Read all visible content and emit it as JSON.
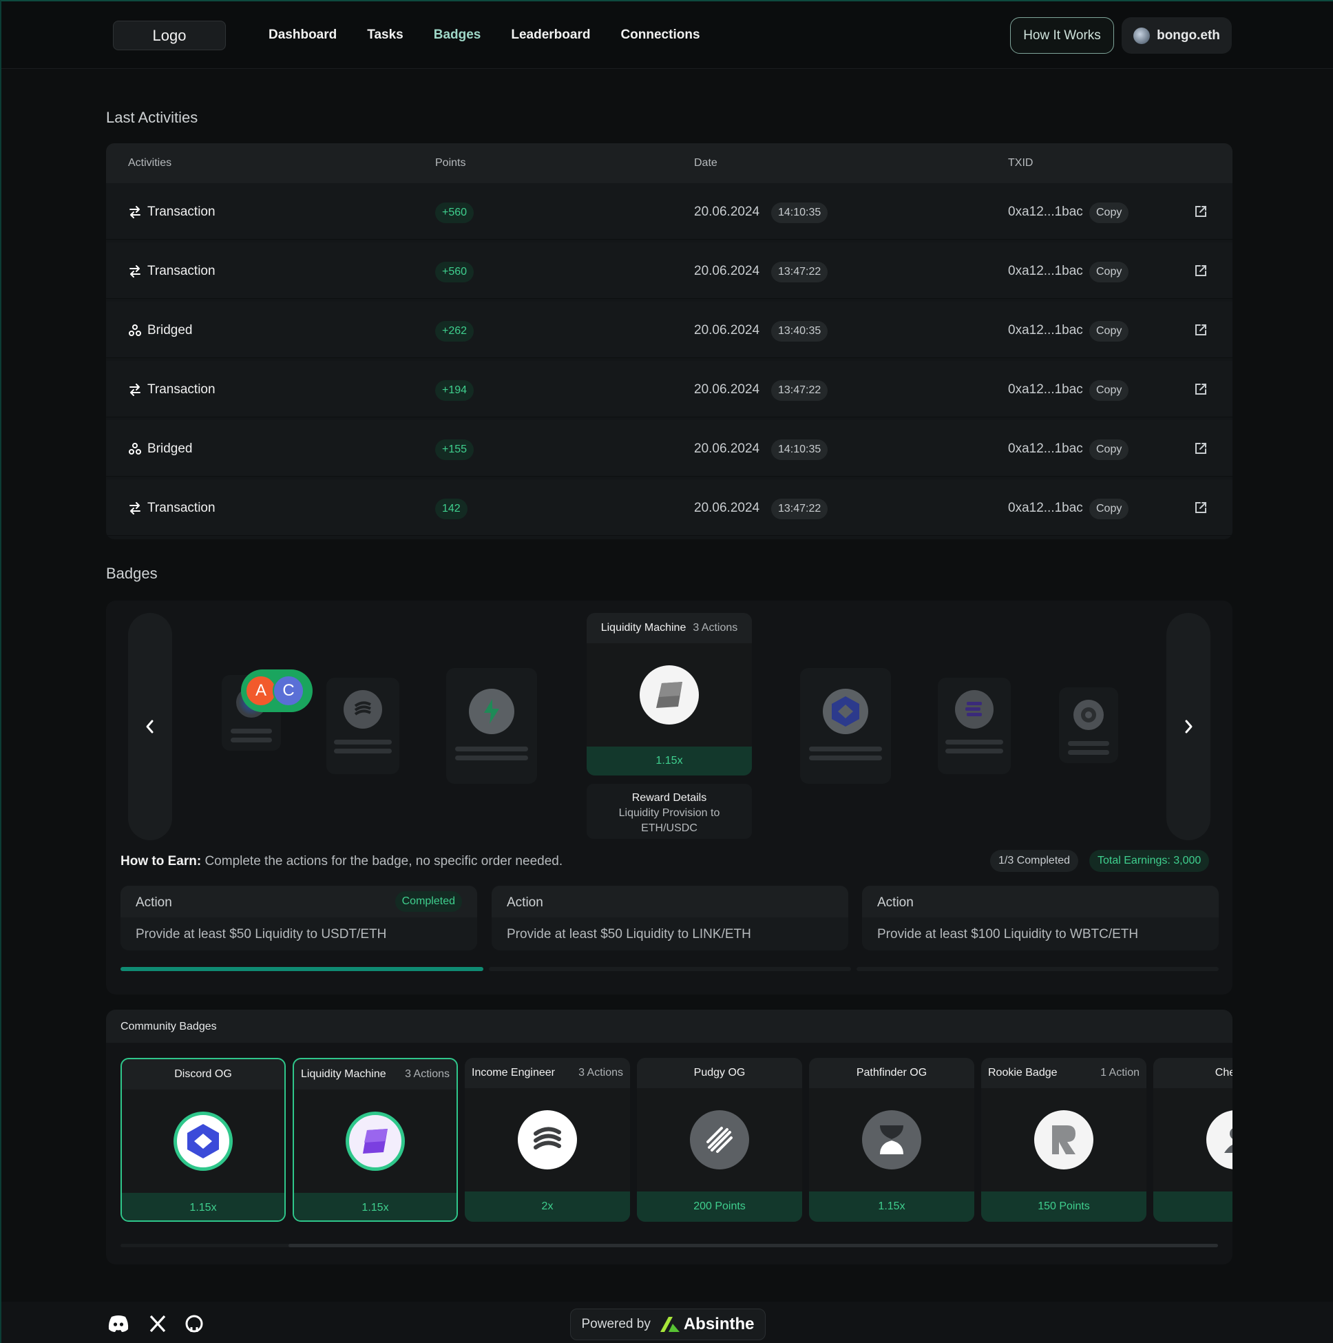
{
  "header": {
    "logo": "Logo",
    "nav": [
      "Dashboard",
      "Tasks",
      "Badges",
      "Leaderboard",
      "Connections"
    ],
    "active_nav": "Badges",
    "how_it_works": "How It Works",
    "user": "bongo.eth"
  },
  "activities": {
    "title": "Last Activities",
    "columns": [
      "Activities",
      "Points",
      "Date",
      "TXID"
    ],
    "copy_label": "Copy",
    "rows": [
      {
        "type": "Transaction",
        "icon": "swap-icon",
        "points": "+560",
        "date": "20.06.2024",
        "time": "14:10:35",
        "txid": "0xa12...1bac"
      },
      {
        "type": "Transaction",
        "icon": "swap-icon",
        "points": "+560",
        "date": "20.06.2024",
        "time": "13:47:22",
        "txid": "0xa12...1bac"
      },
      {
        "type": "Bridged",
        "icon": "bridge-icon",
        "points": "+262",
        "date": "20.06.2024",
        "time": "13:40:35",
        "txid": "0xa12...1bac"
      },
      {
        "type": "Transaction",
        "icon": "swap-icon",
        "points": "+194",
        "date": "20.06.2024",
        "time": "13:47:22",
        "txid": "0xa12...1bac"
      },
      {
        "type": "Bridged",
        "icon": "bridge-icon",
        "points": "+155",
        "date": "20.06.2024",
        "time": "14:10:35",
        "txid": "0xa12...1bac"
      },
      {
        "type": "Transaction",
        "icon": "swap-icon",
        "points": "142",
        "date": "20.06.2024",
        "time": "13:47:22",
        "txid": "0xa12...1bac"
      }
    ]
  },
  "badges": {
    "title": "Badges",
    "avatars": [
      "A",
      "C"
    ],
    "featured": {
      "name": "Liquidity Machine",
      "actions": "3 Actions",
      "multiplier": "1.15x",
      "reward_title": "Reward Details",
      "reward_text": "Liquidity Provision to ETH/USDC"
    },
    "how_to_earn_label": "How to Earn:",
    "how_to_earn_text": "Complete the actions for the badge, no specific order needed.",
    "completed": "1/3 Completed",
    "total_earnings": "Total Earnings: 3,000",
    "action_label": "Action",
    "completed_badge": "Completed",
    "actions": [
      {
        "text": "Provide at least $50 Liquidity to USDT/ETH",
        "done": true
      },
      {
        "text": "Provide at least $50 Liquidity to LINK/ETH",
        "done": false
      },
      {
        "text": "Provide at least $100 Liquidity to WBTC/ETH",
        "done": false
      }
    ],
    "progress": {
      "completed": 1,
      "total": 3
    }
  },
  "community": {
    "title": "Community Badges",
    "cards": [
      {
        "name": "Discord OG",
        "actions": "",
        "value": "1.15x",
        "selected": true,
        "icon": "hexagon-badge-icon"
      },
      {
        "name": "Liquidity Machine",
        "actions": "3 Actions",
        "value": "1.15x",
        "selected": true,
        "icon": "liquidity-badge-icon"
      },
      {
        "name": "Income Engineer",
        "actions": "3 Actions",
        "value": "2x",
        "selected": false,
        "icon": "waves-badge-icon"
      },
      {
        "name": "Pudgy OG",
        "actions": "",
        "value": "200 Points",
        "selected": false,
        "icon": "stripes-badge-icon"
      },
      {
        "name": "Pathfinder OG",
        "actions": "",
        "value": "1.15x",
        "selected": false,
        "icon": "hourglass-badge-icon"
      },
      {
        "name": "Rookie Badge",
        "actions": "1 Action",
        "value": "150 Points",
        "selected": false,
        "icon": "r-badge-icon"
      },
      {
        "name": "Check B",
        "actions": "",
        "value": "",
        "selected": false,
        "icon": "person-badge-icon"
      }
    ]
  },
  "footer": {
    "social": [
      "discord-icon",
      "x-icon",
      "github-icon"
    ],
    "powered_by": "Powered by",
    "brand": "Absinthe"
  },
  "colors": {
    "accent": "#3fcf8e",
    "accent_dark": "#13382c",
    "progress": "#0f8b73",
    "background": "#0d0f10",
    "active_nav": "#9fd8c8"
  }
}
